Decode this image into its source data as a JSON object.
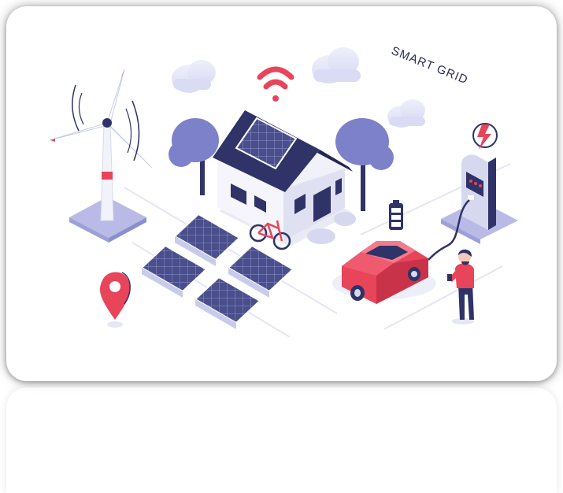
{
  "scene": {
    "heading": "SMART GRID",
    "icons": {
      "wifi": "wifi-icon",
      "lightning": "lightning-icon",
      "location": "location-pin-icon",
      "battery": "battery-icon"
    },
    "colors": {
      "accent_red": "#e8445a",
      "navy": "#2f3367",
      "lavender": "#b9bbe6",
      "tree_blue": "#7d81c9",
      "solar_panel": "#4a4f8c",
      "floor": "#f3f4fb"
    }
  }
}
